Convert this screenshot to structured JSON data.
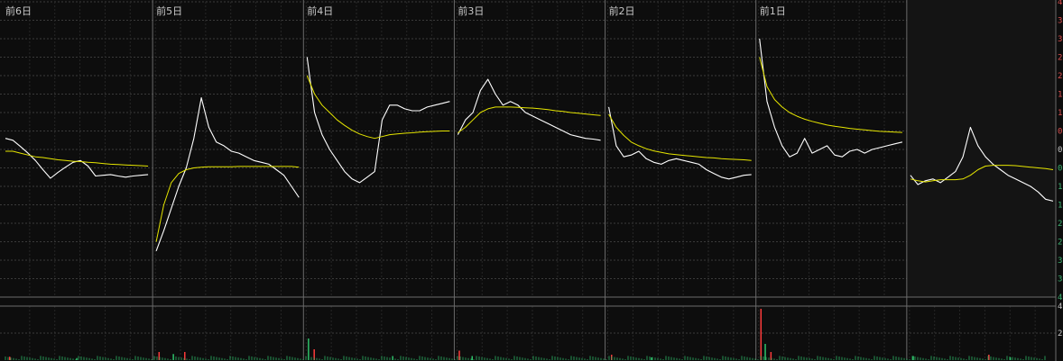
{
  "chart_data": {
    "type": "line",
    "day_labels": [
      "前6日",
      "前5日",
      "前4日",
      "前3日",
      "前2日",
      "前1日",
      ""
    ],
    "series": [
      {
        "color": "#ffffff",
        "days": [
          [
            0.3,
            0.25,
            0.08,
            -0.1,
            -0.3,
            -0.55,
            -0.78,
            -0.62,
            -0.48,
            -0.35,
            -0.3,
            -0.45,
            -0.72,
            -0.7,
            -0.68,
            -0.72,
            -0.75,
            -0.72,
            -0.7,
            -0.68
          ],
          [
            -2.75,
            -2.2,
            -1.6,
            -1.0,
            -0.5,
            0.3,
            1.4,
            0.6,
            0.2,
            0.1,
            -0.05,
            -0.1,
            -0.2,
            -0.3,
            -0.35,
            -0.4,
            -0.55,
            -0.7,
            -1.0,
            -1.3
          ],
          [
            2.5,
            1.0,
            0.4,
            0.0,
            -0.3,
            -0.6,
            -0.8,
            -0.9,
            -0.75,
            -0.6,
            0.8,
            1.2,
            1.2,
            1.1,
            1.05,
            1.05,
            1.15,
            1.2,
            1.25,
            1.3
          ],
          [
            0.4,
            0.8,
            1.0,
            1.6,
            1.9,
            1.5,
            1.2,
            1.3,
            1.2,
            1.0,
            0.9,
            0.8,
            0.7,
            0.6,
            0.5,
            0.4,
            0.35,
            0.3,
            0.28,
            0.25
          ],
          [
            1.15,
            0.1,
            -0.2,
            -0.15,
            -0.05,
            -0.25,
            -0.35,
            -0.4,
            -0.3,
            -0.25,
            -0.3,
            -0.35,
            -0.4,
            -0.55,
            -0.65,
            -0.75,
            -0.8,
            -0.75,
            -0.7,
            -0.68
          ],
          [
            3.0,
            1.3,
            0.6,
            0.1,
            -0.2,
            -0.1,
            0.3,
            -0.1,
            0.0,
            0.1,
            -0.15,
            -0.2,
            -0.05,
            0.0,
            -0.1,
            0.0,
            0.05,
            0.1,
            0.15,
            0.2
          ],
          [
            -0.7,
            -0.95,
            -0.85,
            -0.8,
            -0.9,
            -0.75,
            -0.6,
            -0.2,
            0.6,
            0.1,
            -0.2,
            -0.4,
            -0.55,
            -0.7,
            -0.8,
            -0.9,
            -1.0,
            -1.15,
            -1.35,
            -1.4
          ]
        ]
      },
      {
        "color": "#e6e600",
        "days": [
          [
            -0.05,
            -0.05,
            -0.1,
            -0.15,
            -0.2,
            -0.22,
            -0.25,
            -0.28,
            -0.3,
            -0.32,
            -0.33,
            -0.35,
            -0.36,
            -0.38,
            -0.4,
            -0.41,
            -0.42,
            -0.43,
            -0.44,
            -0.45
          ],
          [
            -2.5,
            -1.5,
            -0.9,
            -0.65,
            -0.55,
            -0.5,
            -0.48,
            -0.47,
            -0.47,
            -0.47,
            -0.47,
            -0.46,
            -0.46,
            -0.46,
            -0.46,
            -0.46,
            -0.46,
            -0.46,
            -0.46,
            -0.48
          ],
          [
            2.0,
            1.5,
            1.2,
            1.0,
            0.8,
            0.65,
            0.52,
            0.42,
            0.35,
            0.3,
            0.35,
            0.4,
            0.42,
            0.44,
            0.45,
            0.47,
            0.48,
            0.49,
            0.5,
            0.5
          ],
          [
            0.45,
            0.6,
            0.8,
            1.0,
            1.1,
            1.15,
            1.15,
            1.15,
            1.14,
            1.13,
            1.12,
            1.1,
            1.08,
            1.05,
            1.03,
            1.0,
            0.98,
            0.96,
            0.94,
            0.92
          ],
          [
            0.95,
            0.6,
            0.38,
            0.2,
            0.1,
            0.02,
            -0.04,
            -0.08,
            -0.12,
            -0.14,
            -0.16,
            -0.18,
            -0.2,
            -0.22,
            -0.23,
            -0.25,
            -0.26,
            -0.27,
            -0.28,
            -0.3
          ],
          [
            2.5,
            1.7,
            1.35,
            1.15,
            1.0,
            0.9,
            0.82,
            0.76,
            0.71,
            0.66,
            0.63,
            0.6,
            0.57,
            0.55,
            0.53,
            0.51,
            0.49,
            0.48,
            0.47,
            0.46
          ],
          [
            -0.8,
            -0.85,
            -0.88,
            -0.85,
            -0.82,
            -0.82,
            -0.82,
            -0.8,
            -0.7,
            -0.55,
            -0.45,
            -0.43,
            -0.43,
            -0.43,
            -0.44,
            -0.46,
            -0.48,
            -0.5,
            -0.52,
            -0.55
          ]
        ]
      }
    ],
    "ylim": [
      -4,
      4
    ],
    "y_ticks": [
      {
        "value": 4,
        "text": "4"
      },
      {
        "value": 3.5,
        "text": "3"
      },
      {
        "value": 3,
        "text": "3"
      },
      {
        "value": 2.5,
        "text": "2"
      },
      {
        "value": 2,
        "text": "2"
      },
      {
        "value": 1.5,
        "text": "1"
      },
      {
        "value": 1,
        "text": "1"
      },
      {
        "value": 0.5,
        "text": "0"
      },
      {
        "value": 0,
        "text": "0"
      },
      {
        "value": -0.5,
        "text": "0"
      },
      {
        "value": -1,
        "text": "1"
      },
      {
        "value": -1.5,
        "text": "1"
      },
      {
        "value": -2,
        "text": "2"
      },
      {
        "value": -2.5,
        "text": "2"
      },
      {
        "value": -3,
        "text": "3"
      },
      {
        "value": -3.5,
        "text": "3"
      },
      {
        "value": -4,
        "text": "4"
      }
    ],
    "volume_ticks": [
      {
        "value": 4,
        "text": "4"
      },
      {
        "value": 2,
        "text": "2"
      }
    ],
    "volume_ylim": [
      0,
      4
    ],
    "volume_spikes": [
      {
        "day": 0,
        "pos": 0.03,
        "value": 0.25
      },
      {
        "day": 0,
        "pos": 0.5,
        "value": 0.15
      },
      {
        "day": 1,
        "pos": 0.02,
        "value": 0.6
      },
      {
        "day": 1,
        "pos": 0.12,
        "value": 0.45
      },
      {
        "day": 1,
        "pos": 0.2,
        "value": 0.6
      },
      {
        "day": 2,
        "pos": 0.01,
        "value": 1.6
      },
      {
        "day": 2,
        "pos": 0.05,
        "value": 0.8
      },
      {
        "day": 2,
        "pos": 0.6,
        "value": 0.3
      },
      {
        "day": 3,
        "pos": 0.01,
        "value": 0.7
      },
      {
        "day": 3,
        "pos": 0.1,
        "value": 0.3
      },
      {
        "day": 4,
        "pos": 0.02,
        "value": 0.4
      },
      {
        "day": 4,
        "pos": 0.3,
        "value": 0.2
      },
      {
        "day": 5,
        "pos": 0.01,
        "value": 3.8
      },
      {
        "day": 5,
        "pos": 0.04,
        "value": 1.2
      },
      {
        "day": 5,
        "pos": 0.08,
        "value": 0.6
      },
      {
        "day": 6,
        "pos": 0.02,
        "value": 0.3
      },
      {
        "day": 6,
        "pos": 0.55,
        "value": 0.4
      },
      {
        "day": 6,
        "pos": 0.7,
        "value": 0.2
      }
    ],
    "colors": {
      "up": "#ff3b3b",
      "down": "#2ec26a",
      "grid": "#3a3a3a",
      "grid_dense": "#262626",
      "divider": "#6a6a6a",
      "ylabel_pos": "#e05050",
      "ylabel_neg": "#3cb371",
      "ylabel_zero": "#c8c8c8"
    },
    "grid": true,
    "legend": "none"
  }
}
